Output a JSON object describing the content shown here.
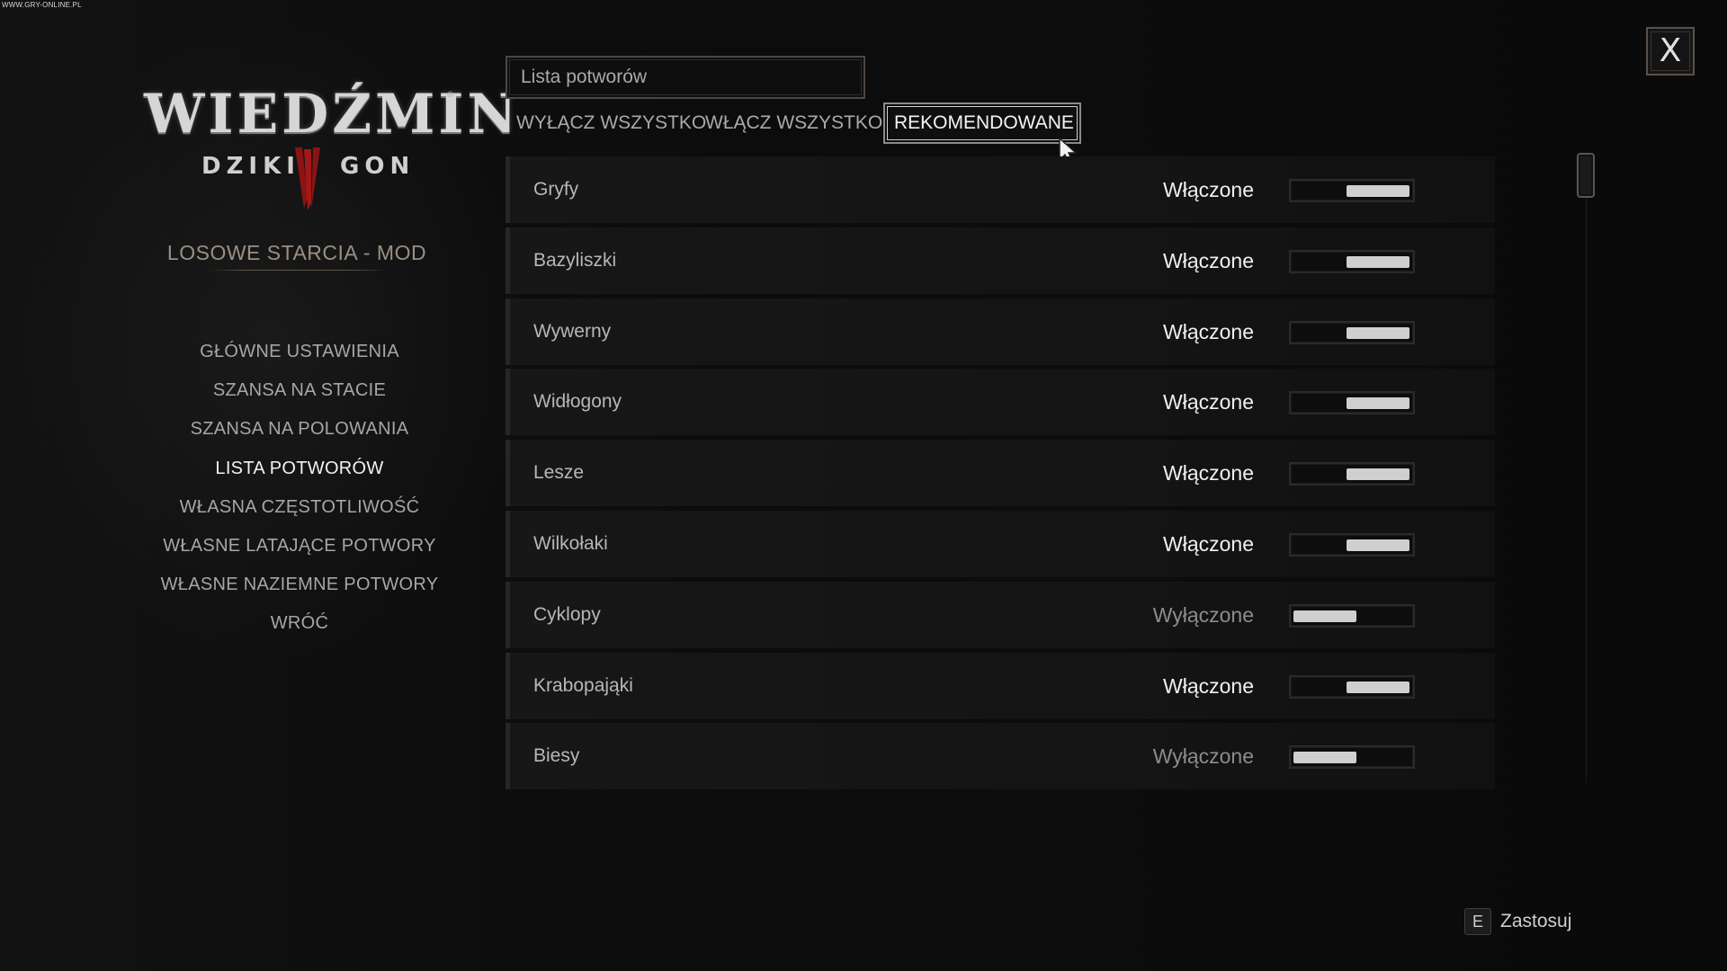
{
  "watermark": "WWW.GRY-ONLINE.PL",
  "logo": {
    "main": "WIEDŹMIN",
    "sub_left": "DZIKI",
    "sub_right": "GON",
    "reg": "®"
  },
  "mod_title": "LOSOWE STARCIA - MOD",
  "menu": {
    "items": [
      {
        "label": "GŁÓWNE USTAWIENIA"
      },
      {
        "label": "SZANSA NA STACIE"
      },
      {
        "label": "SZANSA NA POLOWANIA"
      },
      {
        "label": "LISTA POTWORÓW",
        "active": true
      },
      {
        "label": "WŁASNA CZĘSTOTLIWOŚĆ"
      },
      {
        "label": "WŁASNE LATAJĄCE POTWORY"
      },
      {
        "label": "WŁASNE NAZIEMNE POTWORY"
      },
      {
        "label": "WRÓĆ"
      }
    ]
  },
  "panel": {
    "title_box": "Lista potworów",
    "buttons": {
      "disable_all": "WYŁĄCZ WSZYSTKO",
      "enable_all": "WŁĄCZ WSZYSTKO",
      "recommended": "REKOMENDOWANE"
    },
    "rows": [
      {
        "name": "Gryfy",
        "status": "Włączone",
        "enabled": true
      },
      {
        "name": "Bazyliszki",
        "status": "Włączone",
        "enabled": true
      },
      {
        "name": "Wywerny",
        "status": "Włączone",
        "enabled": true
      },
      {
        "name": "Widłogony",
        "status": "Włączone",
        "enabled": true
      },
      {
        "name": "Lesze",
        "status": "Włączone",
        "enabled": true
      },
      {
        "name": "Wilkołaki",
        "status": "Włączone",
        "enabled": true
      },
      {
        "name": "Cyklopy",
        "status": "Wyłączone",
        "enabled": false
      },
      {
        "name": "Krabopająki",
        "status": "Włączone",
        "enabled": true
      },
      {
        "name": "Biesy",
        "status": "Wyłączone",
        "enabled": false
      }
    ]
  },
  "close": {
    "glyph": "X"
  },
  "apply": {
    "key": "E",
    "label": "Zastosuj"
  }
}
